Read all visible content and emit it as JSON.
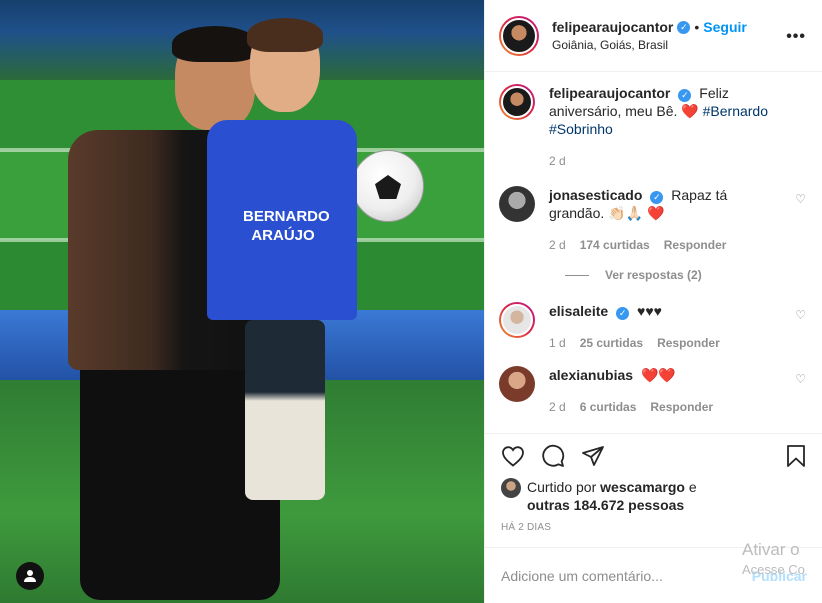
{
  "post": {
    "author": "felipearaujocantor",
    "follow_label": "Seguir",
    "location": "Goiânia, Goiás, Brasil",
    "shirt_text_line1": "BERNARDO",
    "shirt_text_line2": "ARAÚJO"
  },
  "caption": {
    "username": "felipearaujocantor",
    "text": "Feliz aniversário, meu Bê.",
    "hashtags": "#Bernardo #Sobrinho",
    "time": "2 d"
  },
  "comments": [
    {
      "username": "jonasesticado",
      "verified": true,
      "text": "Rapaz tá grandão.",
      "emojis": "👏🏻🙏🏻",
      "time": "2 d",
      "likes": "174 curtidas",
      "reply": "Responder"
    },
    {
      "username": "elisaleite",
      "verified": true,
      "text": "♥♥♥",
      "time": "1 d",
      "likes": "25 curtidas",
      "reply": "Responder"
    },
    {
      "username": "alexianubias",
      "verified": false,
      "text": "",
      "time": "2 d",
      "likes": "6 curtidas",
      "reply": "Responder"
    }
  ],
  "view_replies": "Ver respostas (2)",
  "likes": {
    "prefix": "Curtido por",
    "user": "wescamargo",
    "middle": "e",
    "others": "outras 184.672 pessoas"
  },
  "post_date": "HÁ 2 DIAS",
  "add_comment": {
    "placeholder": "Adicione um comentário...",
    "publish_label": "Publicar"
  },
  "watermark": {
    "line1": "Ativar o",
    "line2": "Acesse Co"
  },
  "colors": {
    "link_blue": "#0095f6",
    "hashtag_blue": "#00376b",
    "heart_red": "#ed4956",
    "muted": "#8e8e8e"
  },
  "icons": [
    "user-tag-icon",
    "verified-badge-icon",
    "more-options-icon",
    "heart-icon",
    "comment-icon",
    "share-icon",
    "bookmark-icon"
  ]
}
